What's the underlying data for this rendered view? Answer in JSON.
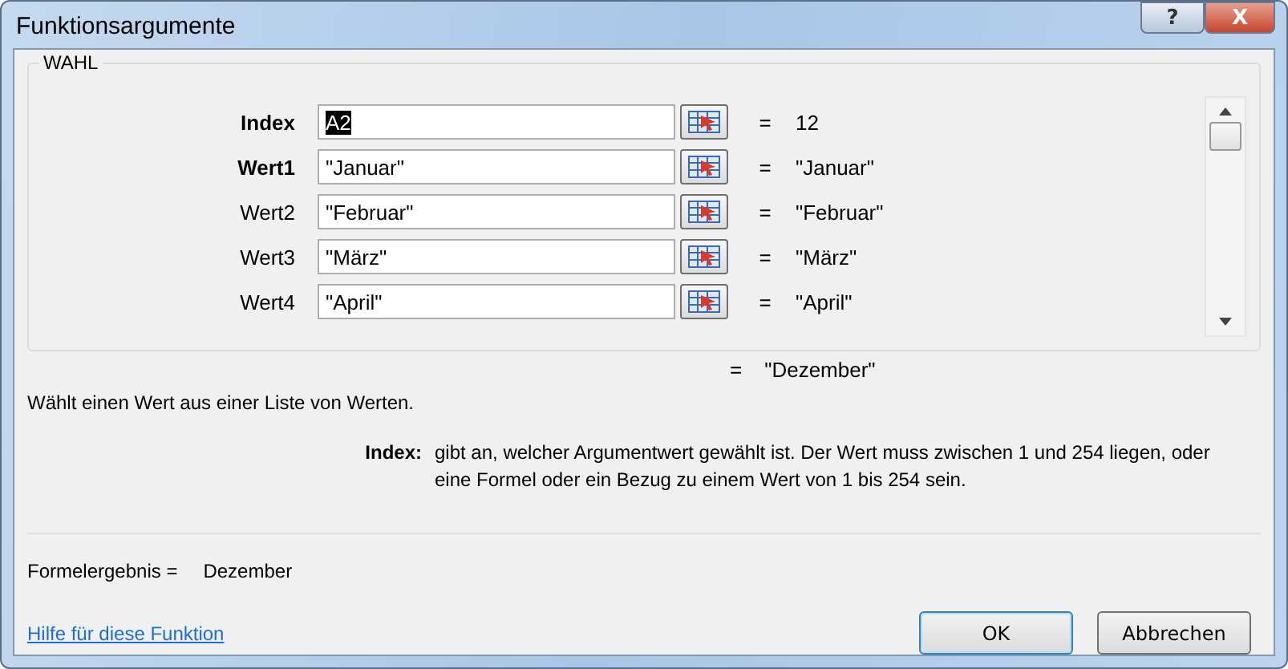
{
  "window": {
    "title": "Funktionsargumente",
    "buttons": [
      {
        "kind": "help",
        "label": "?"
      },
      {
        "kind": "close",
        "label": "X"
      }
    ]
  },
  "function_group": {
    "title": "WAHL",
    "arguments": [
      {
        "label": "Index",
        "required": true,
        "value": "A2",
        "highlighted": true,
        "equals": "=",
        "result": "12"
      },
      {
        "label": "Wert1",
        "required": true,
        "value": "\"Januar\"",
        "highlighted": false,
        "equals": "=",
        "result": "\"Januar\""
      },
      {
        "label": "Wert2",
        "required": false,
        "value": "\"Februar\"",
        "highlighted": false,
        "equals": "=",
        "result": "\"Februar\""
      },
      {
        "label": "Wert3",
        "required": false,
        "value": "\"März\"",
        "highlighted": false,
        "equals": "=",
        "result": "\"März\""
      },
      {
        "label": "Wert4",
        "required": false,
        "value": "\"April\"",
        "highlighted": false,
        "equals": "=",
        "result": "\"April\""
      }
    ]
  },
  "function_result": {
    "equals": "=",
    "value": "\"Dezember\""
  },
  "description": "Wählt einen Wert aus einer Liste von Werten.",
  "argument_help": {
    "label": "Index:",
    "text": "gibt an, welcher Argumentwert gewählt ist. Der Wert muss zwischen 1 und 254 liegen, oder eine Formel oder ein Bezug zu einem Wert von 1 bis 254 sein."
  },
  "formula_result": {
    "label": "Formelergebnis =",
    "value": "Dezember"
  },
  "help_link": "Hilfe für diese Funktion",
  "buttons": [
    {
      "label": "OK",
      "default": true
    },
    {
      "label": "Abbrechen",
      "default": false
    }
  ]
}
